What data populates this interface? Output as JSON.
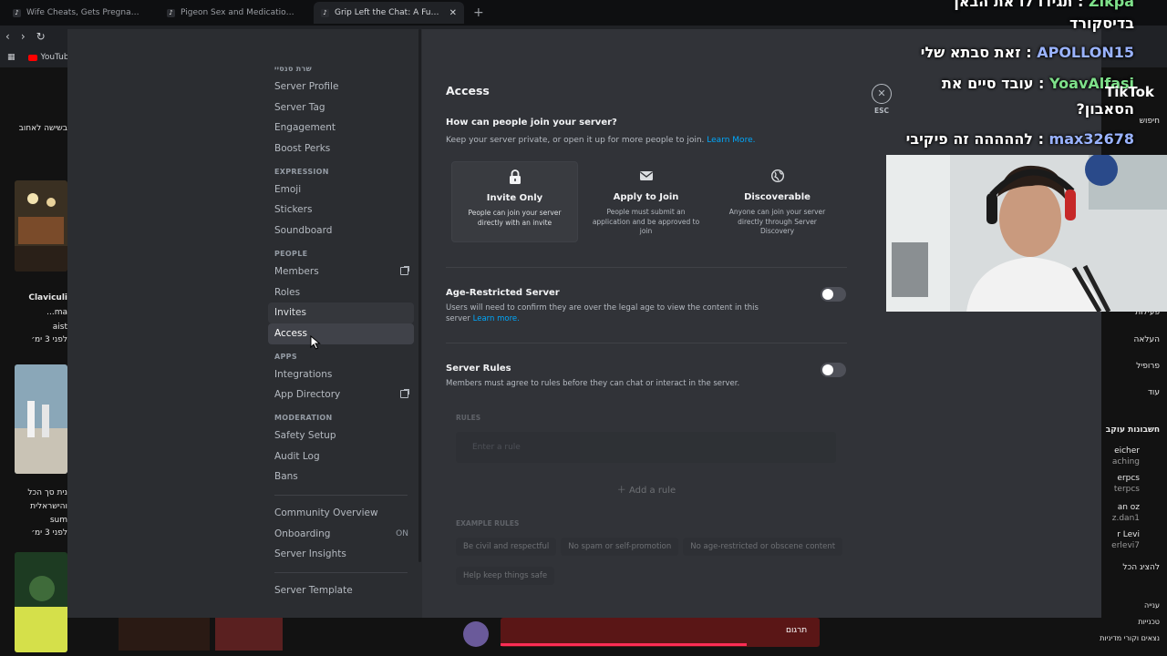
{
  "browser": {
    "tabs": [
      {
        "title": "Wife Cheats, Gets Pregnant, Expects",
        "active": false
      },
      {
        "title": "Pigeon Sex and Medication Woes | T",
        "active": false
      },
      {
        "title": "Grip Left the Chat: A Fun Vietnam",
        "active": true
      }
    ],
    "new_tab": "+",
    "bookmark_youtube": "YouTube"
  },
  "sidebar": {
    "sections": [
      {
        "header": "שרת סנסיי",
        "items": [
          {
            "label": "Server Profile"
          },
          {
            "label": "Server Tag"
          },
          {
            "label": "Engagement"
          },
          {
            "label": "Boost Perks"
          }
        ]
      },
      {
        "header": "EXPRESSION",
        "items": [
          {
            "label": "Emoji"
          },
          {
            "label": "Stickers"
          },
          {
            "label": "Soundboard"
          }
        ]
      },
      {
        "header": "PEOPLE",
        "items": [
          {
            "label": "Members",
            "external": true
          },
          {
            "label": "Roles"
          },
          {
            "label": "Invites",
            "hover": true
          },
          {
            "label": "Access",
            "active": true
          }
        ]
      },
      {
        "header": "APPS",
        "items": [
          {
            "label": "Integrations"
          },
          {
            "label": "App Directory",
            "external": true
          }
        ]
      },
      {
        "header": "MODERATION",
        "items": [
          {
            "label": "Safety Setup"
          },
          {
            "label": "Audit Log"
          },
          {
            "label": "Bans"
          }
        ]
      }
    ],
    "extra_items": [
      {
        "label": "Community Overview"
      },
      {
        "label": "Onboarding",
        "badge": "ON"
      },
      {
        "label": "Server Insights"
      }
    ],
    "template_item": {
      "label": "Server Template"
    }
  },
  "access": {
    "title": "Access",
    "join_question": "How can people join your server?",
    "join_desc": "Keep your server private, or open it up for more people to join.",
    "learn_more": "Learn More.",
    "options": [
      {
        "label": "Invite Only",
        "desc": "People can join your server directly with an invite",
        "icon": "lock-icon",
        "selected": true
      },
      {
        "label": "Apply to Join",
        "desc": "People must submit an application and be approved to join",
        "icon": "envelope-icon",
        "selected": false
      },
      {
        "label": "Discoverable",
        "desc": "Anyone can join your server directly through Server Discovery",
        "icon": "globe-icon",
        "selected": false
      }
    ],
    "age_restricted": {
      "title": "Age-Restricted Server",
      "desc": "Users will need to confirm they are over the legal age to view the content in this server",
      "link": "Learn more.",
      "enabled": false
    },
    "server_rules": {
      "title": "Server Rules",
      "desc": "Members must agree to rules before they can chat or interact in the server.",
      "enabled": false
    },
    "rules_label": "RULES",
    "rule_placeholder": "Enter a rule",
    "add_rule": "Add a rule",
    "example_label": "EXAMPLE RULES",
    "examples": [
      "Be civil and respectful",
      "No spam or self-promotion",
      "No age-restricted or obscene content",
      "Help keep things safe"
    ],
    "close_label": "ESC"
  },
  "overlay": {
    "chat": [
      {
        "user": "Zikpa",
        "sep": ":",
        "msg": "תגידו לו את הבאן"
      },
      {
        "user": "",
        "sep": "",
        "msg": "בדיסקורד"
      },
      {
        "user": "APOLLON15",
        "sep": ":",
        "msg": "זאת סבתא שלי"
      },
      {
        "user": "YoavAlfasi",
        "sep": ":",
        "msg": "עובד סיים את"
      },
      {
        "user": "",
        "sep": "",
        "msg": "הסאבון?"
      },
      {
        "user": "max32678",
        "sep": ":",
        "msg": "לההההה זה פיקיבי"
      }
    ],
    "tiktok": "TikTok"
  },
  "tiktok_bg": {
    "left_captions": [
      "בשישה לאחוב",
      "Claviculi",
      "...ma",
      "aist",
      "לפני 3 ימ׳",
      "נית סך הכל",
      "והישראלית",
      "sum",
      "לפני 3 ימ׳"
    ],
    "right_rows": [
      "חיפוש",
      "פעילות",
      "העלאה",
      "פרופיל",
      "עוד",
      "חשבונות עוקב",
      "eicher",
      "aching",
      "erpcs",
      "terpcs",
      "an oz",
      "z.dan1",
      "r Levi",
      "erlevi7",
      "להציג הכל",
      "ענייה",
      "טכנייות",
      "נצאים וקורי מדיניות",
      "תרגום"
    ]
  },
  "colors": {
    "accent": "#00a8fc",
    "active_nav": "#404249",
    "modal_bg": "#313338",
    "sidebar_bg": "#2b2d31"
  }
}
